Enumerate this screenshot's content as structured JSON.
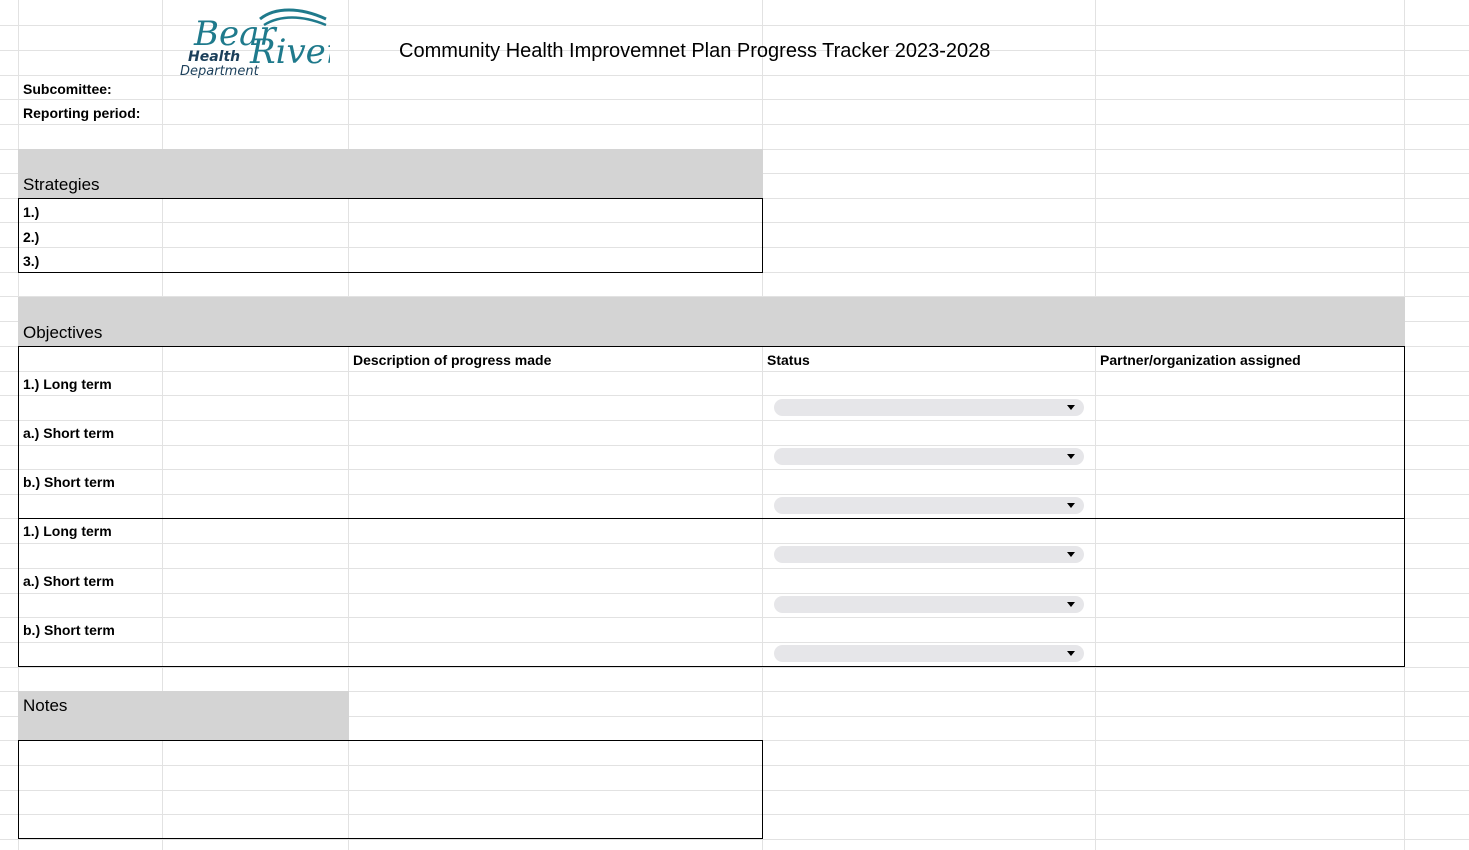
{
  "header": {
    "logo_text": {
      "bear": "Bear",
      "river": "River",
      "health": "Health",
      "department": "Department"
    },
    "title": "Community Health Improvemnet Plan Progress Tracker 2023-2028"
  },
  "meta_fields": {
    "subcommittee_label": "Subcomittee:",
    "reporting_period_label": "Reporting period:"
  },
  "strategies": {
    "heading": "Strategies",
    "items": [
      "1.)",
      "2.)",
      "3.)"
    ]
  },
  "objectives": {
    "heading": "Objectives",
    "columns": {
      "description": "Description of progress made",
      "status": "Status",
      "partner": "Partner/organization assigned"
    },
    "rows": [
      {
        "label": "1.) Long term"
      },
      {
        "label": "a.) Short term"
      },
      {
        "label": "b.) Short term"
      },
      {
        "label": "1.) Long term"
      },
      {
        "label": "a.) Short term"
      },
      {
        "label": "b.) Short term"
      }
    ]
  },
  "notes": {
    "heading": "Notes"
  },
  "colors": {
    "section_fill": "#d4d4d4",
    "gridline": "#e2e2e2",
    "dropdown_fill": "#e6e6e9",
    "logo_teal": "#1f7a8c"
  },
  "icons": {
    "dropdown": "caret-down-icon"
  }
}
